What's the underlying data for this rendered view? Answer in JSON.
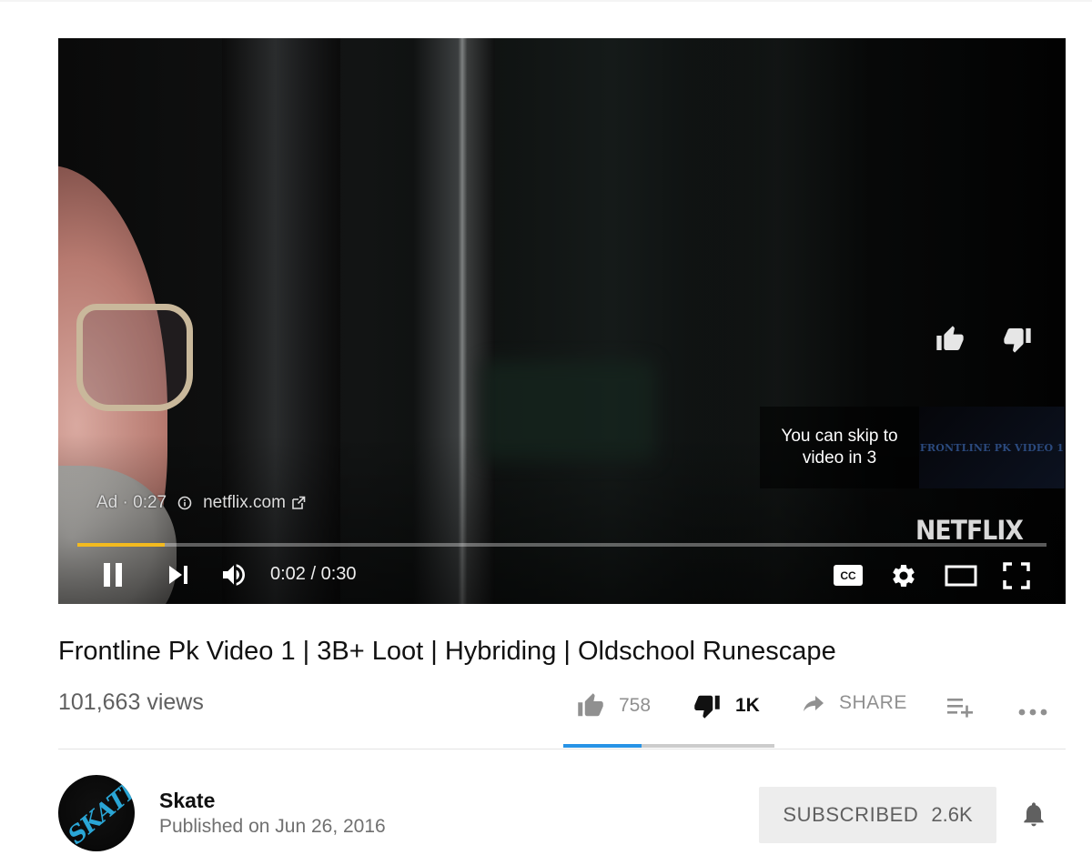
{
  "player": {
    "ad_label": "Ad · 0:27",
    "ad_domain": "netflix.com",
    "skip_text": "You can skip to video in 3",
    "skip_thumb_text": "FRONTLINE PK VIDEO 1",
    "brand_logo": "NETFLIX",
    "time": "0:02 / 0:30",
    "progress_fraction": 0.09,
    "progress_color": "#f3ba1f",
    "icons": [
      "pause-icon",
      "next-icon",
      "volume-icon",
      "captions-icon",
      "gear-icon",
      "theater-mode-icon",
      "fullscreen-icon",
      "thumbs-up-icon",
      "thumbs-down-icon"
    ]
  },
  "video": {
    "title": "Frontline Pk Video 1 | 3B+ Loot | Hybriding | Oldschool Runescape",
    "views": "101,663 views",
    "likes": "758",
    "dislikes": "1K",
    "share_label": "SHARE",
    "like_fraction": 0.37,
    "like_bar_color": "#2793e6"
  },
  "channel": {
    "name": "Skate",
    "avatar_text": "SKATE",
    "published": "Published on Jun 26, 2016",
    "subscribe_label": "SUBSCRIBED",
    "subscriber_count": "2.6K"
  }
}
